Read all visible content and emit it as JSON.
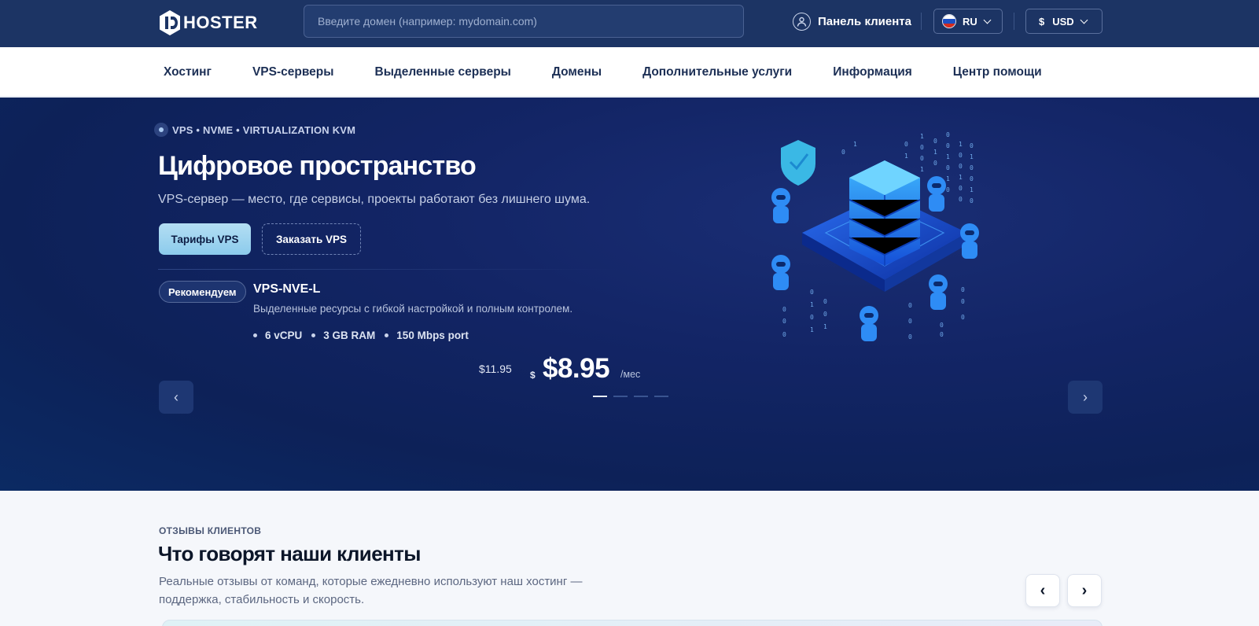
{
  "header": {
    "logo_text": "HOSTER",
    "search_placeholder": "Введите домен (например: mydomain.com)",
    "client_panel": "Панель клиента",
    "language": "RU",
    "currency_symbol": "$",
    "currency": "USD"
  },
  "nav": {
    "items": [
      "Хостинг",
      "VPS-серверы",
      "Выделенные серверы",
      "Домены",
      "Дополнительные услуги",
      "Информация",
      "Центр помощи"
    ]
  },
  "hero": {
    "eyebrow": "VPS • NVME • VIRTUALIZATION KVM",
    "title": "Цифровое пространство",
    "subtitle": "VPS-сервер — место, где сервисы, проекты работают без лишнего шума.",
    "primary_button": "Тарифы VPS",
    "secondary_button": "Заказать VPS",
    "badge": "Рекомендуем",
    "plan_name": "VPS-NVE-L",
    "plan_description": "Выделенные ресурсы с гибкой настройкой и полным контролем.",
    "specs": [
      "6 vCPU",
      "3 GB RAM",
      "150 Mbps port"
    ],
    "old_price": "$11.95",
    "price_currency": "$",
    "price": "$8.95",
    "period": "/мес",
    "prev_arrow": "‹",
    "next_arrow": "›",
    "slides_count": 4,
    "active_slide": 1
  },
  "reviews": {
    "eyebrow": "ОТЗЫВЫ КЛИЕНТОВ",
    "title": "Что говорят наши клиенты",
    "subtitle": "Реальные отзывы от команд, которые ежедневно используют наш хостинг — поддержка, стабильность и скорость.",
    "prev_arrow": "‹",
    "next_arrow": "›"
  },
  "colors": {
    "topbar": "#1c3464",
    "hero_bg": "#0d2158",
    "accent": "#8ccbec"
  },
  "icons": [
    "user-icon",
    "flag-ru-icon",
    "chevron-down-icon",
    "logo-icon",
    "server-illustration"
  ]
}
